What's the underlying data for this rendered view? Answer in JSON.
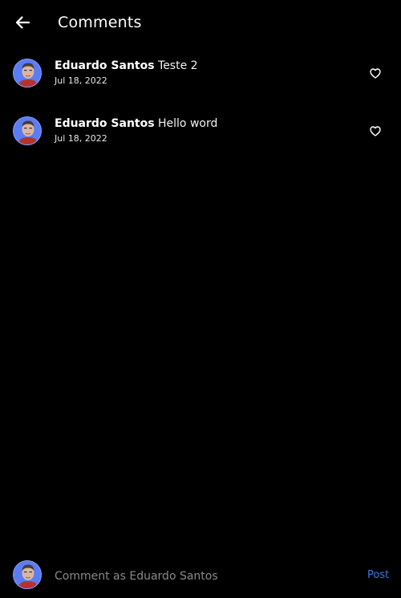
{
  "header": {
    "title": "Comments",
    "back_icon": "arrow-left-icon"
  },
  "comments": [
    {
      "user": "Eduardo Santos",
      "text": "Teste 2",
      "date": "Jul 18, 2022",
      "like_icon": "heart-outline-icon"
    },
    {
      "user": "Eduardo Santos",
      "text": "Hello word",
      "date": "Jul 18, 2022",
      "like_icon": "heart-outline-icon"
    }
  ],
  "composer": {
    "placeholder": "Comment as Eduardo Santos",
    "value": "",
    "post_label": "Post"
  },
  "colors": {
    "background": "#000000",
    "text": "#ffffff",
    "accent": "#3d7be0",
    "placeholder": "#8a8a8a",
    "avatar_bg": "#5b7cf3"
  }
}
